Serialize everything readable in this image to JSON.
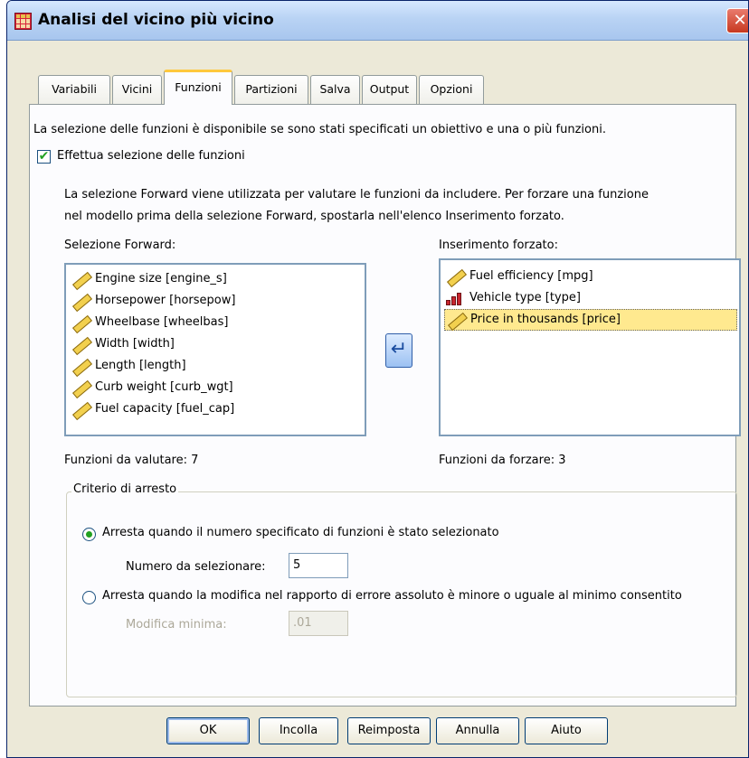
{
  "window": {
    "title": "Analisi del vicino più vicino",
    "close_glyph": "✕"
  },
  "tabs": [
    "Variabili",
    "Vicini",
    "Funzioni",
    "Partizioni",
    "Salva",
    "Output",
    "Opzioni"
  ],
  "active_tab": "Funzioni",
  "info_text": "La selezione delle funzioni è disponibile se sono stati specificati un obiettivo e una o più funzioni.",
  "perform_selection": {
    "label": "Effettua selezione delle funzioni",
    "checked": true
  },
  "description": [
    "La selezione Forward viene utilizzata per valutare le funzioni da includere. Per forzare una funzione",
    "nel modello prima della selezione Forward, spostarla nell'elenco Inserimento forzato."
  ],
  "forward_list": {
    "label": "Selezione Forward:",
    "items": [
      {
        "label": "Engine size [engine_s]",
        "icon": "scale-ruler-icon"
      },
      {
        "label": "Horsepower [horsepow]",
        "icon": "scale-ruler-icon"
      },
      {
        "label": "Wheelbase [wheelbas]",
        "icon": "scale-ruler-icon"
      },
      {
        "label": "Width [width]",
        "icon": "scale-ruler-icon"
      },
      {
        "label": "Length [length]",
        "icon": "scale-ruler-icon"
      },
      {
        "label": "Curb weight [curb_wgt]",
        "icon": "scale-ruler-icon"
      },
      {
        "label": "Fuel capacity [fuel_cap]",
        "icon": "scale-ruler-icon"
      }
    ],
    "count_label": "Funzioni da valutare:",
    "count": "7"
  },
  "move_button_glyph": "↵",
  "forced_list": {
    "label": "Inserimento forzato:",
    "items": [
      {
        "label": "Fuel efficiency [mpg]",
        "icon": "scale-ruler-icon"
      },
      {
        "label": "Vehicle type [type]",
        "icon": "nominal-bars-icon"
      },
      {
        "label": "Price in thousands [price]",
        "icon": "scale-ruler-icon",
        "selected": true
      }
    ],
    "count_label": "Funzioni da forzare:",
    "count": "3"
  },
  "stopping": {
    "legend": "Criterio di arresto",
    "option1": "Arresta quando il numero specificato di funzioni è stato selezionato",
    "option1_selected": true,
    "number_label": "Numero da selezionare:",
    "number_value": "5",
    "option2": "Arresta quando la modifica nel rapporto di errore assoluto è minore o uguale al minimo consentito",
    "min_change_label": "Modifica minima:",
    "min_change_value": ".01"
  },
  "buttons": {
    "ok": "OK",
    "paste": "Incolla",
    "reset": "Reimposta",
    "cancel": "Annulla",
    "help": "Aiuto"
  }
}
